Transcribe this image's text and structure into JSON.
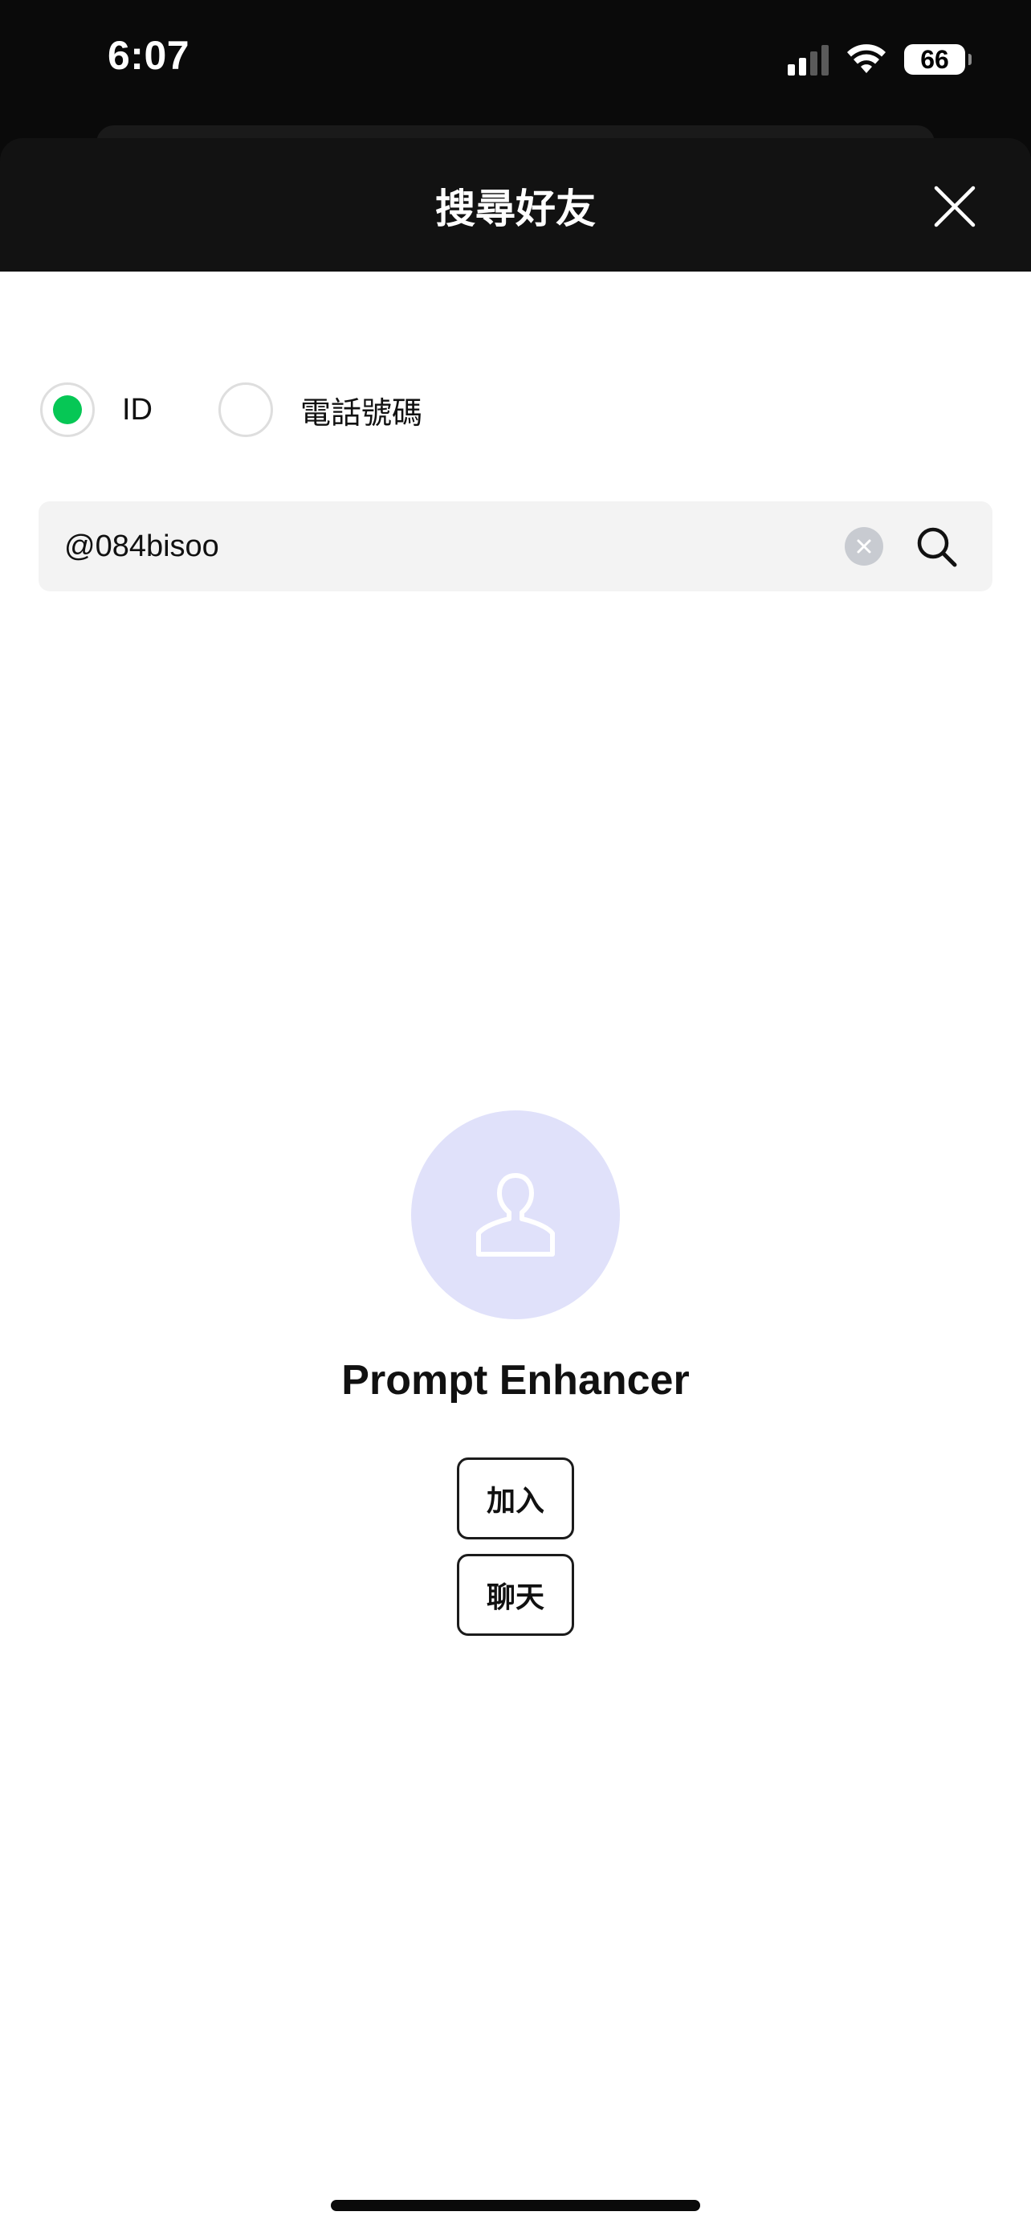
{
  "status_bar": {
    "time": "6:07",
    "battery": "66",
    "icons": [
      "signal-icon",
      "wifi-icon",
      "battery-icon"
    ]
  },
  "header": {
    "title": "搜尋好友",
    "close_icon": "close-icon"
  },
  "search_type": {
    "options": [
      {
        "label": "ID",
        "selected": true
      },
      {
        "label": "電話號碼",
        "selected": false
      }
    ]
  },
  "search": {
    "value": "@084bisoo",
    "clear_icon": "clear-icon",
    "search_icon": "search-icon"
  },
  "result": {
    "avatar_icon": "person-icon",
    "name": "Prompt Enhancer",
    "add_label": "加入",
    "chat_label": "聊天"
  },
  "colors": {
    "accent_green": "#06c755",
    "header_bg": "#121212",
    "avatar_bg": "#e0e1fa",
    "search_bg": "#f3f3f3"
  }
}
